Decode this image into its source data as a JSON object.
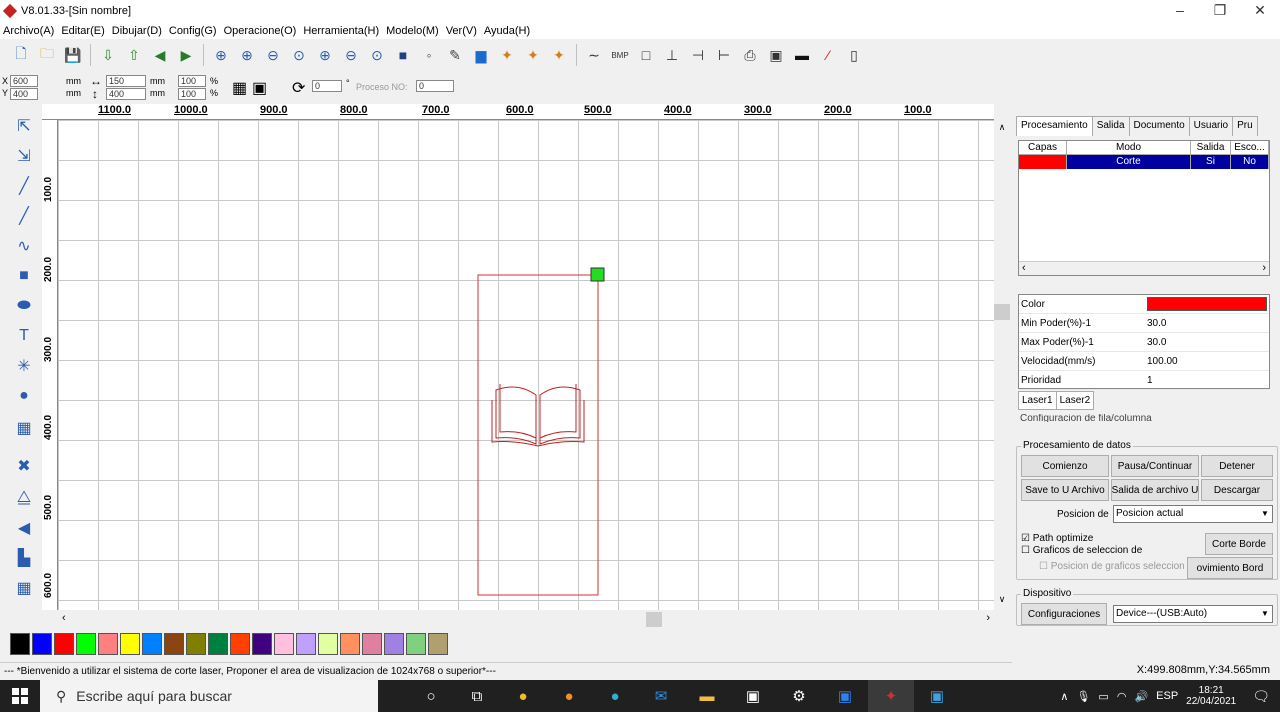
{
  "window": {
    "title": "V8.01.33-[Sin nombre]",
    "min": "–",
    "max": "❐",
    "close": "✕"
  },
  "menu": [
    "Archivo(A)",
    "Editar(E)",
    "Dibujar(D)",
    "Config(G)",
    "Operacione(O)",
    "Herramienta(H)",
    "Modelo(M)",
    "Ver(V)",
    "Ayuda(H)"
  ],
  "toolbar2": {
    "x_label": "X",
    "y_label": "Y",
    "x_value": "600",
    "y_value": "400",
    "unit_mm": "mm",
    "w_value": "150",
    "h_value": "400",
    "scale_x": "100",
    "scale_y": "100",
    "pct": "%",
    "rotate_value": "0",
    "deg": "°",
    "proceso_label": "Proceso NO:",
    "proceso_value": "0"
  },
  "rulers": {
    "h": [
      "1100.0",
      "1000.0",
      "900.0",
      "800.0",
      "700.0",
      "600.0",
      "500.0",
      "400.0",
      "300.0",
      "200.0",
      "100.0"
    ],
    "v": [
      "100.0",
      "200.0",
      "300.0",
      "400.0",
      "500.0",
      "600.0"
    ]
  },
  "palette": [
    "#000000",
    "#0000ff",
    "#ff0000",
    "#00ff00",
    "#ff8080",
    "#ffff00",
    "#0080ff",
    "#8b4513",
    "#808000",
    "#008040",
    "#ff4000",
    "#400080",
    "#ffc0e0",
    "#c0a0ff",
    "#e0ffa0",
    "#ff9060",
    "#e080a0",
    "#a080e0",
    "#80d080",
    "#b0a070"
  ],
  "status": {
    "message": "--- *Bienvenido a utilizar el sistema de corte laser, Proponer el area de visualizacion de 1024x768 o superior*---",
    "coords": "X:499.808mm,Y:34.565mm"
  },
  "panel": {
    "tabs": [
      "Procesamiento",
      "Salida",
      "Documento",
      "Usuario",
      "Pru"
    ],
    "layer_headers": [
      "Capas",
      "Modo",
      "Salida",
      "Esco..."
    ],
    "layer_row": {
      "color": "#ff0000",
      "mode": "Corte",
      "output": "Si",
      "hide": "No"
    },
    "props": [
      {
        "key": "Color",
        "value": ""
      },
      {
        "key": "Min Poder(%)-1",
        "value": "30.0"
      },
      {
        "key": "Max Poder(%)-1",
        "value": "30.0"
      },
      {
        "key": "Velocidad(mm/s)",
        "value": "100.00"
      },
      {
        "key": "Prioridad",
        "value": "1"
      }
    ],
    "laser_tabs": [
      "Laser1",
      "Laser2"
    ],
    "truncated_label": "Configuracion de fila/columna",
    "data_group": "Procesamiento de datos",
    "buttons": {
      "start": "Comienzo",
      "pause": "Pausa/Continuar",
      "stop": "Detener",
      "save_u": "Save to U Archivo",
      "output_u": "Salida de archivo U",
      "download": "Descargar",
      "corte_borde": "Corte Borde",
      "mov_borde": "ovimiento Bord"
    },
    "position_label": "Posicion de",
    "position_value": "Posicion actual",
    "path_optimize": "Path optimize",
    "graficos": "Graficos de seleccion de",
    "posicion_graficos": "Posicion de graficos seleccionadc",
    "device_group": "Dispositivo",
    "config_button": "Configuraciones",
    "device_value": "Device---(USB:Auto)"
  },
  "taskbar": {
    "search": "Escribe aquí para buscar",
    "lang": "ESP",
    "time": "18:21",
    "date": "22/04/2021"
  },
  "icons": [
    "new-file-icon",
    "open-folder-icon",
    "save-icon",
    "import-icon",
    "export-icon",
    "undo-icon",
    "redo-icon",
    "zoom-icon",
    "laser-app-icon"
  ]
}
